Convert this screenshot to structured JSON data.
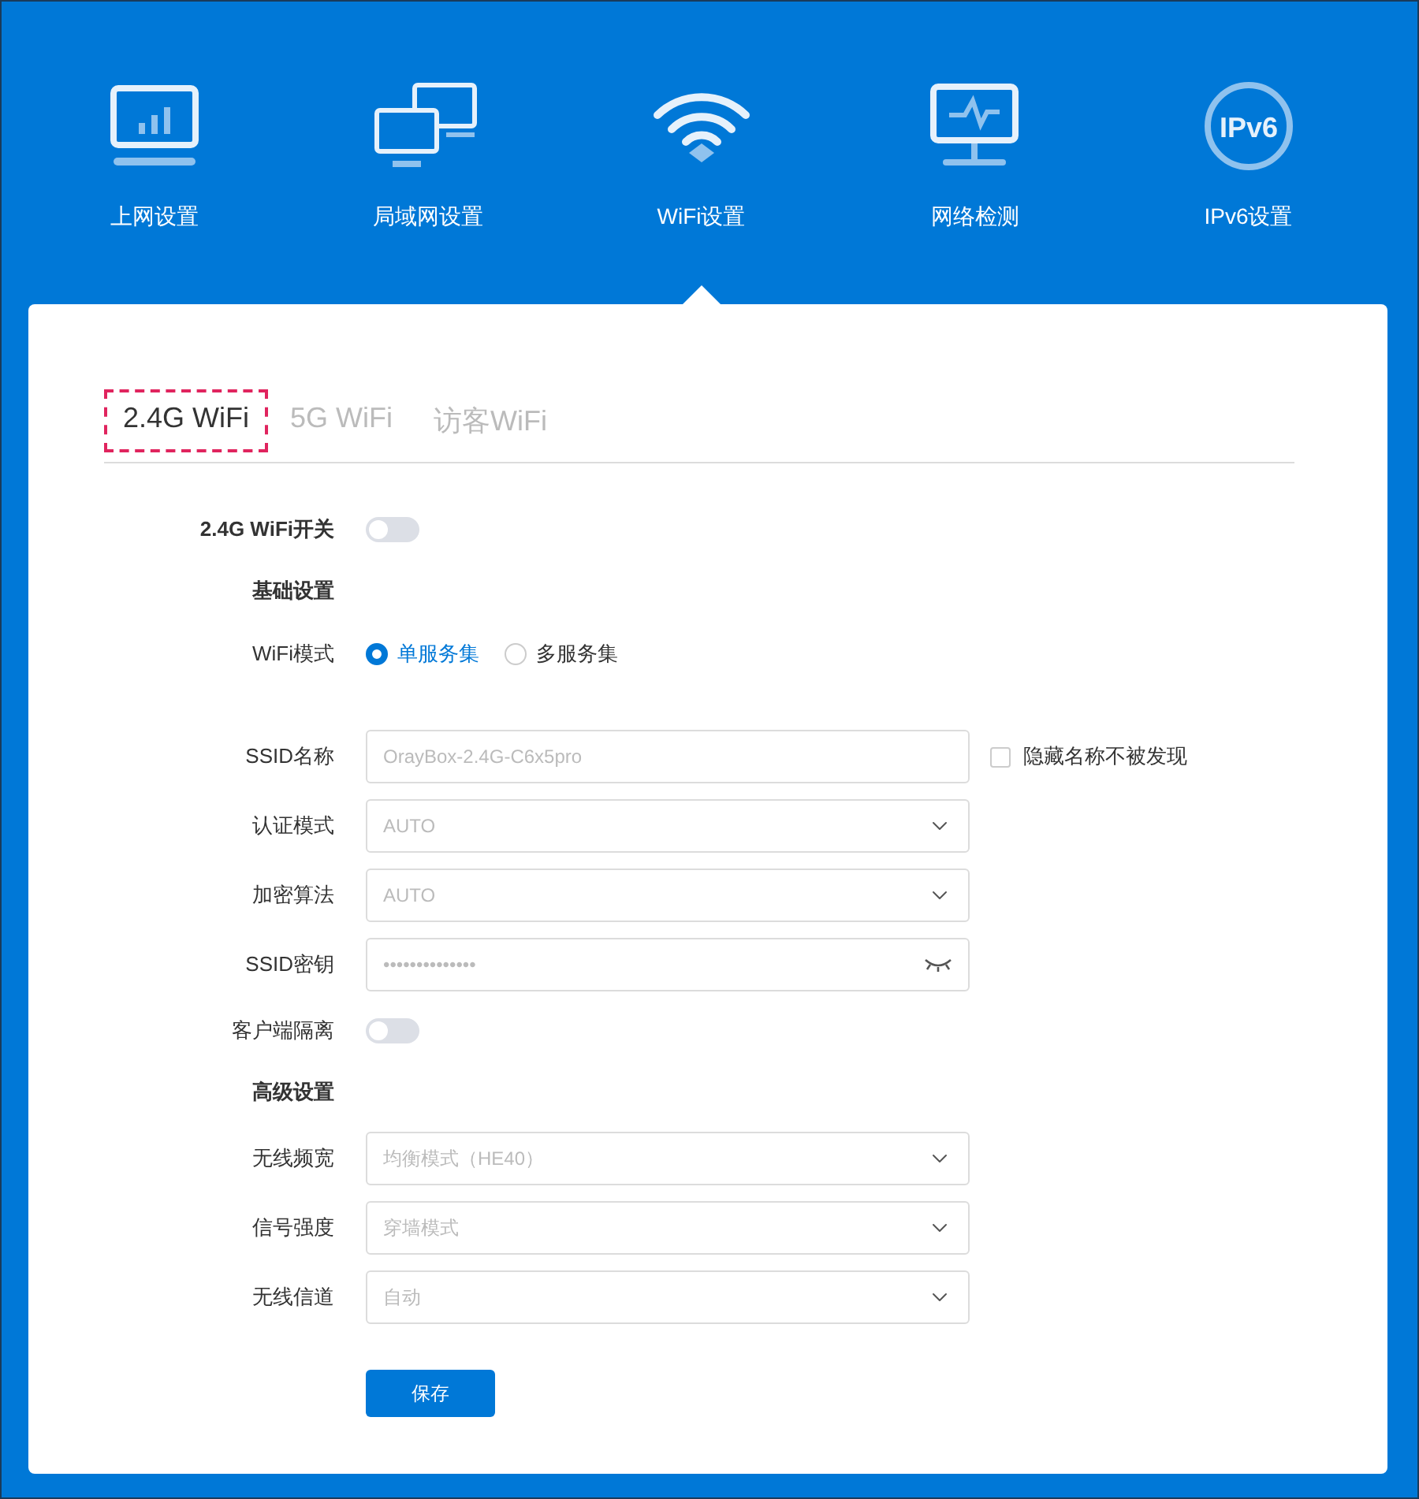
{
  "nav": [
    {
      "label": "上网设置",
      "kind": "internet",
      "selected": false
    },
    {
      "label": "局域网设置",
      "kind": "lan",
      "selected": false
    },
    {
      "label": "WiFi设置",
      "kind": "wifi",
      "selected": true
    },
    {
      "label": "网络检测",
      "kind": "diagnose",
      "selected": false
    },
    {
      "label": "IPv6设置",
      "kind": "ipv6",
      "selected": false,
      "icon_text": "IPv6"
    }
  ],
  "tabs": [
    {
      "label": "2.4G WiFi",
      "selected": true
    },
    {
      "label": "5G WiFi",
      "selected": false
    },
    {
      "label": "访客WiFi",
      "selected": false
    }
  ],
  "form": [
    {
      "kind": "toggle",
      "label": "2.4G WiFi开关",
      "on": false,
      "bold": true
    },
    {
      "kind": "section",
      "label": "基础设置"
    },
    {
      "kind": "radio",
      "label": "WiFi模式",
      "options": [
        {
          "label": "单服务集",
          "selected": true
        },
        {
          "label": "多服务集",
          "selected": false
        }
      ]
    },
    {
      "kind": "text",
      "label": "SSID名称",
      "placeholder": "OrayBox-2.4G-C6x5pro",
      "checkbox": {
        "label": "隐藏名称不被发现",
        "checked": false
      }
    },
    {
      "kind": "select",
      "label": "认证模式",
      "value": "AUTO"
    },
    {
      "kind": "select",
      "label": "加密算法",
      "value": "AUTO"
    },
    {
      "kind": "password",
      "label": "SSID密钥",
      "value": "••••••••••••••"
    },
    {
      "kind": "toggle",
      "label": "客户端隔离",
      "on": false
    },
    {
      "kind": "section",
      "label": "高级设置"
    },
    {
      "kind": "select",
      "label": "无线频宽",
      "value": "均衡模式（HE40）"
    },
    {
      "kind": "select",
      "label": "信号强度",
      "value": "穿墙模式"
    },
    {
      "kind": "select",
      "label": "无线信道",
      "value": "自动"
    }
  ],
  "save_button": "保存"
}
